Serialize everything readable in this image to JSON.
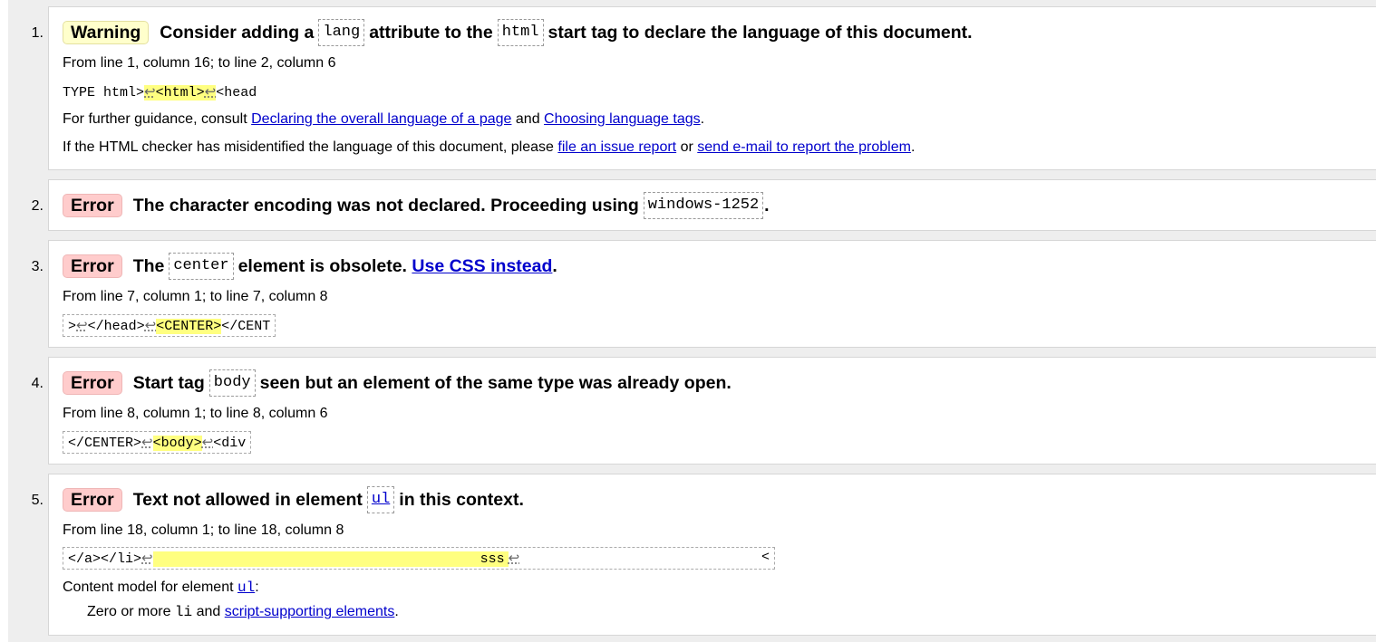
{
  "messages": [
    {
      "num": "1.",
      "type": "Warning",
      "title_pre": "Consider adding a",
      "code1": "lang",
      "title_mid": "attribute to the",
      "code2": "html",
      "title_post": "start tag to declare the language of this document.",
      "location": "From line 1, column 16; to line 2, column 6",
      "extract_pre": "TYPE html>",
      "extract_nl1": "↩",
      "extract_hl": "<html>",
      "extract_nl2": "↩",
      "extract_post": "<head",
      "guidance_pre": "For further guidance, consult",
      "guidance_link1": "Declaring the overall language of a page",
      "guidance_and": "and",
      "guidance_link2": "Choosing language tags",
      "guidance_end": ".",
      "mis_pre": "If the HTML checker has misidentified the language of this document, please",
      "mis_link1": "file an issue report",
      "mis_or": "or",
      "mis_link2": "send e-mail to report the problem",
      "mis_end": "."
    },
    {
      "num": "2.",
      "type": "Error",
      "title_pre": "The character encoding was not declared. Proceeding using",
      "code1": "windows-1252",
      "title_post": "."
    },
    {
      "num": "3.",
      "type": "Error",
      "title_pre": "The",
      "code1": "center",
      "title_mid": "element is obsolete.",
      "title_link": "Use CSS instead",
      "title_post": ".",
      "location": "From line 7, column 1; to line 7, column 8",
      "extract_pre": ">",
      "extract_nl1": "↩",
      "extract_mid": "</head>",
      "extract_nl2": "↩",
      "extract_hl": "<CENTER>",
      "extract_post": "</CENT"
    },
    {
      "num": "4.",
      "type": "Error",
      "title_pre": "Start tag",
      "code1": "body",
      "title_post": "seen but an element of the same type was already open.",
      "location": "From line 8, column 1; to line 8, column 6",
      "extract_pre": "</CENTER>",
      "extract_nl1": "↩",
      "extract_hl": "<body>",
      "extract_nl2": "↩",
      "extract_post": "<div"
    },
    {
      "num": "5.",
      "type": "Error",
      "title_pre": "Text not allowed in element",
      "code1": "ul",
      "title_post": "in this context.",
      "location": "From line 18, column 1; to line 18, column 8",
      "extract_pre": "</a></li>",
      "extract_nl1": "↩",
      "extract_hl_text": "sss",
      "extract_nl2": "↩",
      "extract_post": "<",
      "content_model_pre": "Content model for element",
      "content_model_code": "ul",
      "content_model_end": ":",
      "model_pre": "Zero or more",
      "model_code": "li",
      "model_and": "and",
      "model_link": "script-supporting elements",
      "model_end": "."
    }
  ],
  "colors": {
    "warning_bg": "#ffffcc",
    "error_bg": "#ffcccc",
    "link": "#0000cc",
    "highlight": "#ffff80"
  }
}
